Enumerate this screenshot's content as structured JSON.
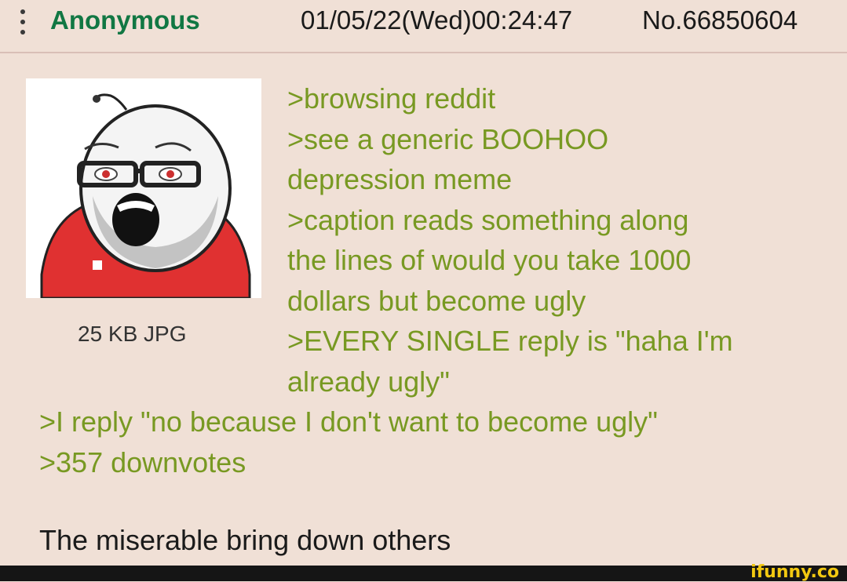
{
  "post": {
    "name": "Anonymous",
    "datetime": "01/05/22(Wed)00:24:47",
    "number": "No.66850604"
  },
  "file": {
    "info": "25 KB JPG"
  },
  "lines_right": [
    ">browsing reddit",
    ">see a generic BOOHOO",
    "depression meme",
    ">caption reads something along",
    "the lines of would you take 1000",
    "dollars but become ugly",
    ">EVERY SINGLE reply is \"haha I'm",
    "already ugly\""
  ],
  "lines_full": [
    ">I reply \"no because I don't want to become ugly\"",
    ">357 downvotes"
  ],
  "caption": "The miserable bring down others",
  "watermark": "ifunny.co",
  "colors": {
    "background": "#f0e0d6",
    "name": "#117743",
    "greentext": "#789922",
    "shirt": "#e03131"
  }
}
